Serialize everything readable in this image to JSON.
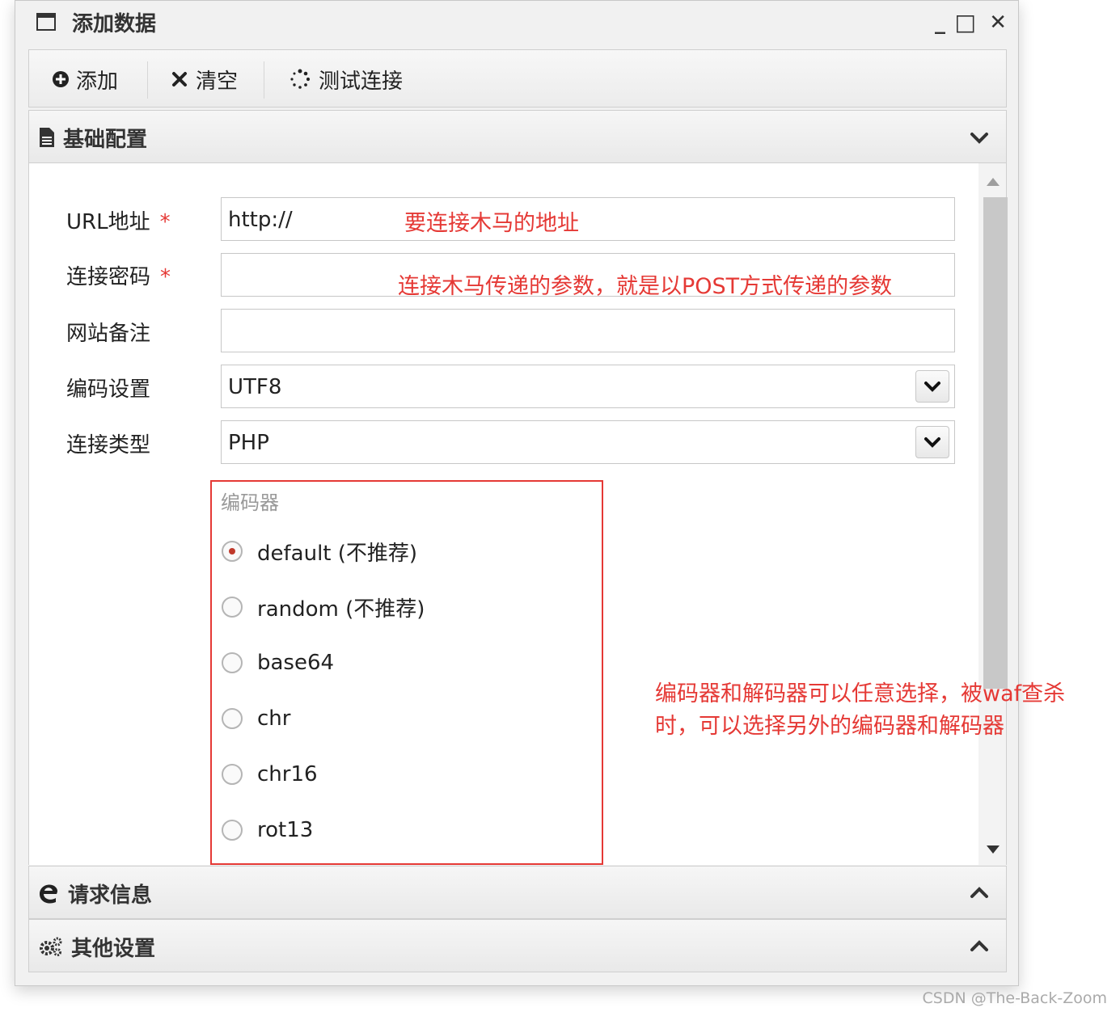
{
  "window": {
    "title": "添加数据",
    "minimize": "_",
    "maximize": "□",
    "close": "✕"
  },
  "toolbar": {
    "add_label": "添加",
    "clear_label": "清空",
    "test_label": "测试连接"
  },
  "basic_config": {
    "header": "基础配置",
    "fields": {
      "url_label": "URL地址",
      "url_value": "http://",
      "password_label": "连接密码",
      "password_value": "",
      "note_label": "网站备注",
      "note_value": "",
      "encoding_label": "编码设置",
      "encoding_value": "UTF8",
      "type_label": "连接类型",
      "type_value": "PHP"
    },
    "required_mark": "*",
    "encoder": {
      "legend": "编码器",
      "options": [
        "default (不推荐)",
        "random (不推荐)",
        "base64",
        "chr",
        "chr16",
        "rot13"
      ],
      "selected": "default (不推荐)"
    }
  },
  "annotations": {
    "url_note": "要连接木马的地址",
    "password_note": "连接木马传递的参数，就是以POST方式传递的参数",
    "encoder_note_line1": "编码器和解码器可以任意选择，被waf查杀",
    "encoder_note_line2": "时，可以选择另外的编码器和解码器",
    "color": "#e53935"
  },
  "request_info": {
    "header": "请求信息"
  },
  "other_settings": {
    "header": "其他设置"
  },
  "watermark": "CSDN @The-Back-Zoom"
}
